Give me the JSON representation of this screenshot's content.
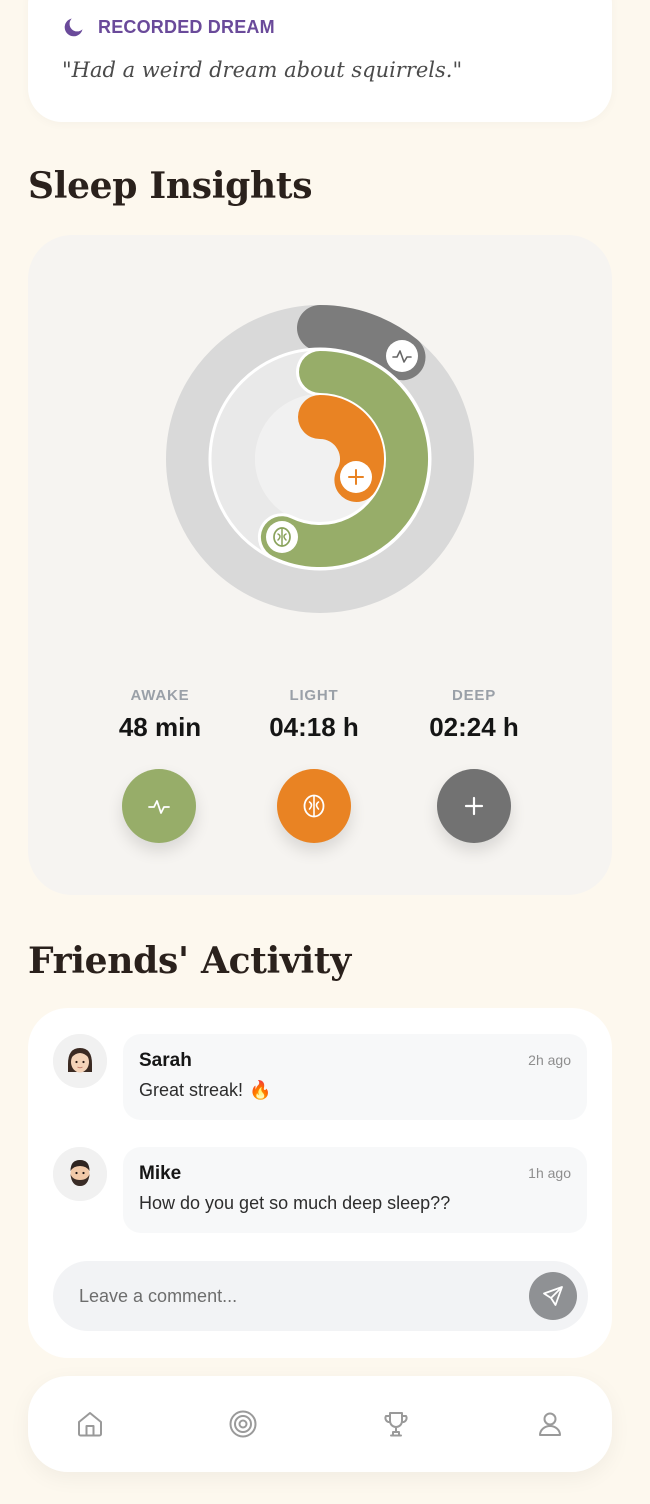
{
  "dream": {
    "label": "RECORDED DREAM",
    "quote": "\"Had a weird dream about squirrels.\"",
    "icon": "moon-icon",
    "accent": "#6a4a9a"
  },
  "insights": {
    "title": "Sleep Insights",
    "stats": [
      {
        "label": "AWAKE",
        "value": "48 min",
        "button_icon": "activity-icon",
        "color": "#97ad69"
      },
      {
        "label": "LIGHT",
        "value": "04:18 h",
        "button_icon": "brain-icon",
        "color": "#e98323"
      },
      {
        "label": "DEEP",
        "value": "02:24 h",
        "button_icon": "plus-icon",
        "color": "#727272"
      }
    ],
    "rings": {
      "outer_color": "#7c7c7c",
      "middle_color": "#97ad69",
      "inner_color": "#e98323",
      "outer_icon": "activity-icon",
      "middle_icon": "brain-icon",
      "inner_icon": "plus-icon"
    }
  },
  "friends": {
    "title": "Friends' Activity",
    "comments": [
      {
        "name": "Sarah",
        "time": "2h ago",
        "text": "Great streak!",
        "emoji": "🔥",
        "avatar": "woman-avatar-icon"
      },
      {
        "name": "Mike",
        "time": "1h ago",
        "text": "How do you get so much deep sleep??",
        "avatar": "bearded-man-avatar-icon"
      }
    ],
    "input": {
      "placeholder": "Leave a comment...",
      "send_icon": "send-icon"
    }
  },
  "nav": {
    "items": [
      {
        "icon": "home-icon"
      },
      {
        "icon": "target-icon"
      },
      {
        "icon": "trophy-icon"
      },
      {
        "icon": "user-icon"
      }
    ]
  }
}
